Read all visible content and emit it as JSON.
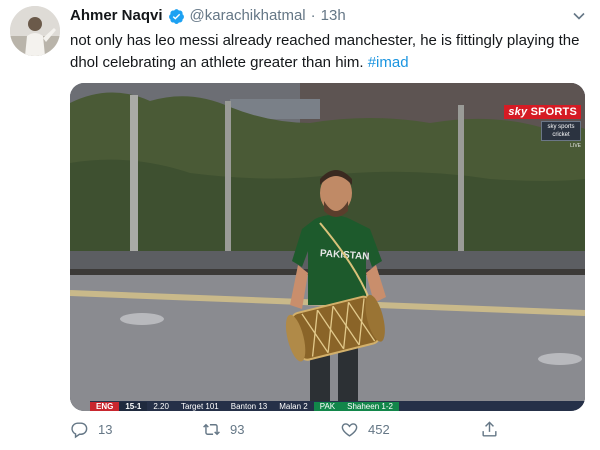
{
  "tweet": {
    "display_name": "Ahmer Naqvi",
    "handle": "@karachikhatmal",
    "separator": "·",
    "time": "13h",
    "verified": true,
    "text": "not only has leo messi already reached manchester, he is fittingly playing the dhol celebrating an athlete greater than him.",
    "hashtag": "#imad"
  },
  "media": {
    "broadcaster": {
      "sky_label": "sky",
      "sports_label": "SPORTS",
      "sub_brand_top": "sky sports",
      "sub_brand_bottom": "cricket",
      "live_label": "LIVE"
    },
    "scorebar": {
      "team": "ENG",
      "score": "15-1",
      "detail": "2.20",
      "target": "Target 101",
      "batsman_1": "Banton 13",
      "batsman_2": "Malan 2",
      "bowling_team": "PAK",
      "bowler": "Shaheen 1-2"
    },
    "jersey_text": "PAKISTAN"
  },
  "actions": {
    "reply_count": "13",
    "retweet_count": "93",
    "like_count": "452"
  },
  "colors": {
    "link": "#1b95e0",
    "verified": "#1da1f2",
    "muted": "#657786",
    "sky_red": "#d51b24",
    "jersey_green": "#1d5a2c"
  }
}
